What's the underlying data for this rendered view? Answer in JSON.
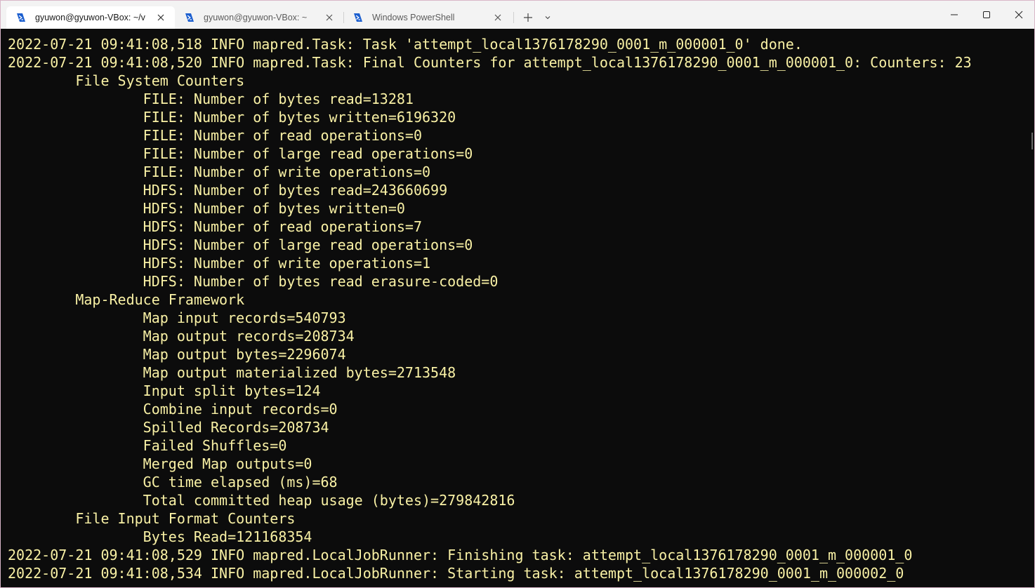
{
  "tabs": [
    {
      "title": "gyuwon@gyuwon-VBox: ~/v",
      "active": true
    },
    {
      "title": "gyuwon@gyuwon-VBox: ~",
      "active": false
    },
    {
      "title": "Windows PowerShell",
      "active": false
    }
  ],
  "icons": {
    "tab": "powershell-icon",
    "close": "close-icon",
    "new_tab": "plus-icon",
    "dropdown": "chevron-down-icon",
    "minimize": "minimize-icon",
    "maximize": "maximize-icon",
    "close_window": "close-window-icon"
  },
  "colors": {
    "terminal_bg": "#0c0c0c",
    "terminal_text": "#f9f1a5",
    "tab_icon": "#1c5fcf"
  },
  "terminal": {
    "lines": [
      "2022-07-21 09:41:08,518 INFO mapred.Task: Task 'attempt_local1376178290_0001_m_000001_0' done.",
      "2022-07-21 09:41:08,520 INFO mapred.Task: Final Counters for attempt_local1376178290_0001_m_000001_0: Counters: 23",
      "        File System Counters",
      "                FILE: Number of bytes read=13281",
      "                FILE: Number of bytes written=6196320",
      "                FILE: Number of read operations=0",
      "                FILE: Number of large read operations=0",
      "                FILE: Number of write operations=0",
      "                HDFS: Number of bytes read=243660699",
      "                HDFS: Number of bytes written=0",
      "                HDFS: Number of read operations=7",
      "                HDFS: Number of large read operations=0",
      "                HDFS: Number of write operations=1",
      "                HDFS: Number of bytes read erasure-coded=0",
      "        Map-Reduce Framework",
      "                Map input records=540793",
      "                Map output records=208734",
      "                Map output bytes=2296074",
      "                Map output materialized bytes=2713548",
      "                Input split bytes=124",
      "                Combine input records=0",
      "                Spilled Records=208734",
      "                Failed Shuffles=0",
      "                Merged Map outputs=0",
      "                GC time elapsed (ms)=68",
      "                Total committed heap usage (bytes)=279842816",
      "        File Input Format Counters",
      "                Bytes Read=121168354",
      "2022-07-21 09:41:08,529 INFO mapred.LocalJobRunner: Finishing task: attempt_local1376178290_0001_m_000001_0",
      "2022-07-21 09:41:08,534 INFO mapred.LocalJobRunner: Starting task: attempt_local1376178290_0001_m_000002_0"
    ]
  }
}
